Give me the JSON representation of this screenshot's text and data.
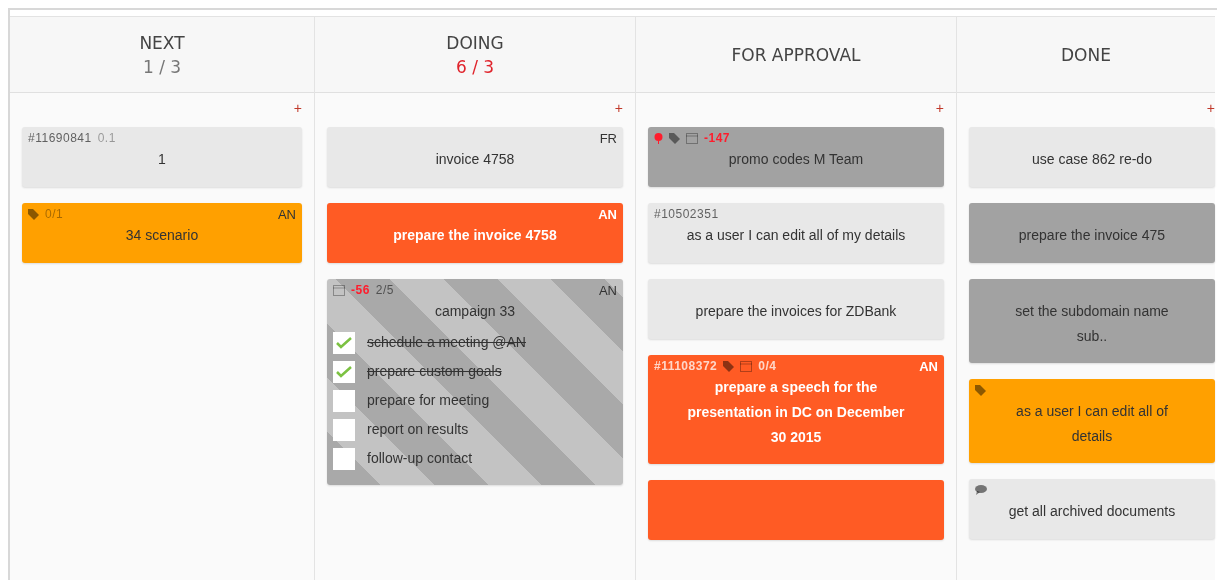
{
  "columns": [
    {
      "title": "NEXT",
      "count": "1 / 3",
      "over_limit": false,
      "add": "+",
      "cards": [
        {
          "kind": "plain",
          "meta": [
            {
              "kind": "text",
              "text": "#11690841"
            },
            {
              "kind": "faint",
              "text": "0.1"
            }
          ],
          "title": "1"
        },
        {
          "kind": "orange",
          "meta": [
            {
              "kind": "tag"
            },
            {
              "kind": "faint",
              "text": "0/1"
            }
          ],
          "initials": "AN",
          "title": "34 scenario"
        }
      ]
    },
    {
      "title": "DOING",
      "count": "6 / 3",
      "over_limit": true,
      "add": "+",
      "cards": [
        {
          "kind": "plain",
          "initials": "FR",
          "title": "invoice 4758"
        },
        {
          "kind": "red",
          "initials": "AN",
          "title": "prepare the invoice 4758"
        },
        {
          "kind": "striped",
          "meta": [
            {
              "kind": "calendar"
            },
            {
              "kind": "alert",
              "text": "-56"
            },
            {
              "kind": "text",
              "text": "2/5"
            }
          ],
          "initials": "AN",
          "title": "campaign 33",
          "checklist": [
            {
              "text": "schedule a meeting @AN",
              "checked": true
            },
            {
              "text": "prepare custom goals",
              "checked": true
            },
            {
              "text": "prepare for meeting",
              "checked": false
            },
            {
              "text": "report on results",
              "checked": false
            },
            {
              "text": "follow-up contact",
              "checked": false
            }
          ]
        }
      ]
    },
    {
      "title": "FOR APPROVAL",
      "add": "+",
      "cards": [
        {
          "kind": "gray",
          "meta": [
            {
              "kind": "pin"
            },
            {
              "kind": "tag"
            },
            {
              "kind": "calendar"
            },
            {
              "kind": "alert",
              "text": "-147"
            }
          ],
          "title": "promo codes M Team"
        },
        {
          "kind": "plain",
          "meta": [
            {
              "kind": "text",
              "text": "#10502351"
            }
          ],
          "title": "as a user I can edit all of my details"
        },
        {
          "kind": "plain",
          "title": "prepare the invoices for ZDBank"
        },
        {
          "kind": "red",
          "meta": [
            {
              "kind": "text",
              "text": "#11108372"
            },
            {
              "kind": "tag"
            },
            {
              "kind": "calendar"
            },
            {
              "kind": "text",
              "text": "0/4"
            }
          ],
          "initials": "AN",
          "title": "prepare a speech for the presentation in DC on December 30 2015"
        },
        {
          "kind": "red"
        }
      ]
    },
    {
      "title": "DONE",
      "add": "+",
      "cards": [
        {
          "kind": "plain",
          "title": "use case 862 re-do"
        },
        {
          "kind": "gray",
          "title": "prepare the invoice 475"
        },
        {
          "kind": "gray",
          "title": "set the subdomain name sub.."
        },
        {
          "kind": "orange",
          "meta": [
            {
              "kind": "tag"
            }
          ],
          "title": "as a user I can edit all of details"
        },
        {
          "kind": "plain",
          "meta": [
            {
              "kind": "comment"
            }
          ],
          "title": "get all archived documents"
        }
      ]
    }
  ]
}
